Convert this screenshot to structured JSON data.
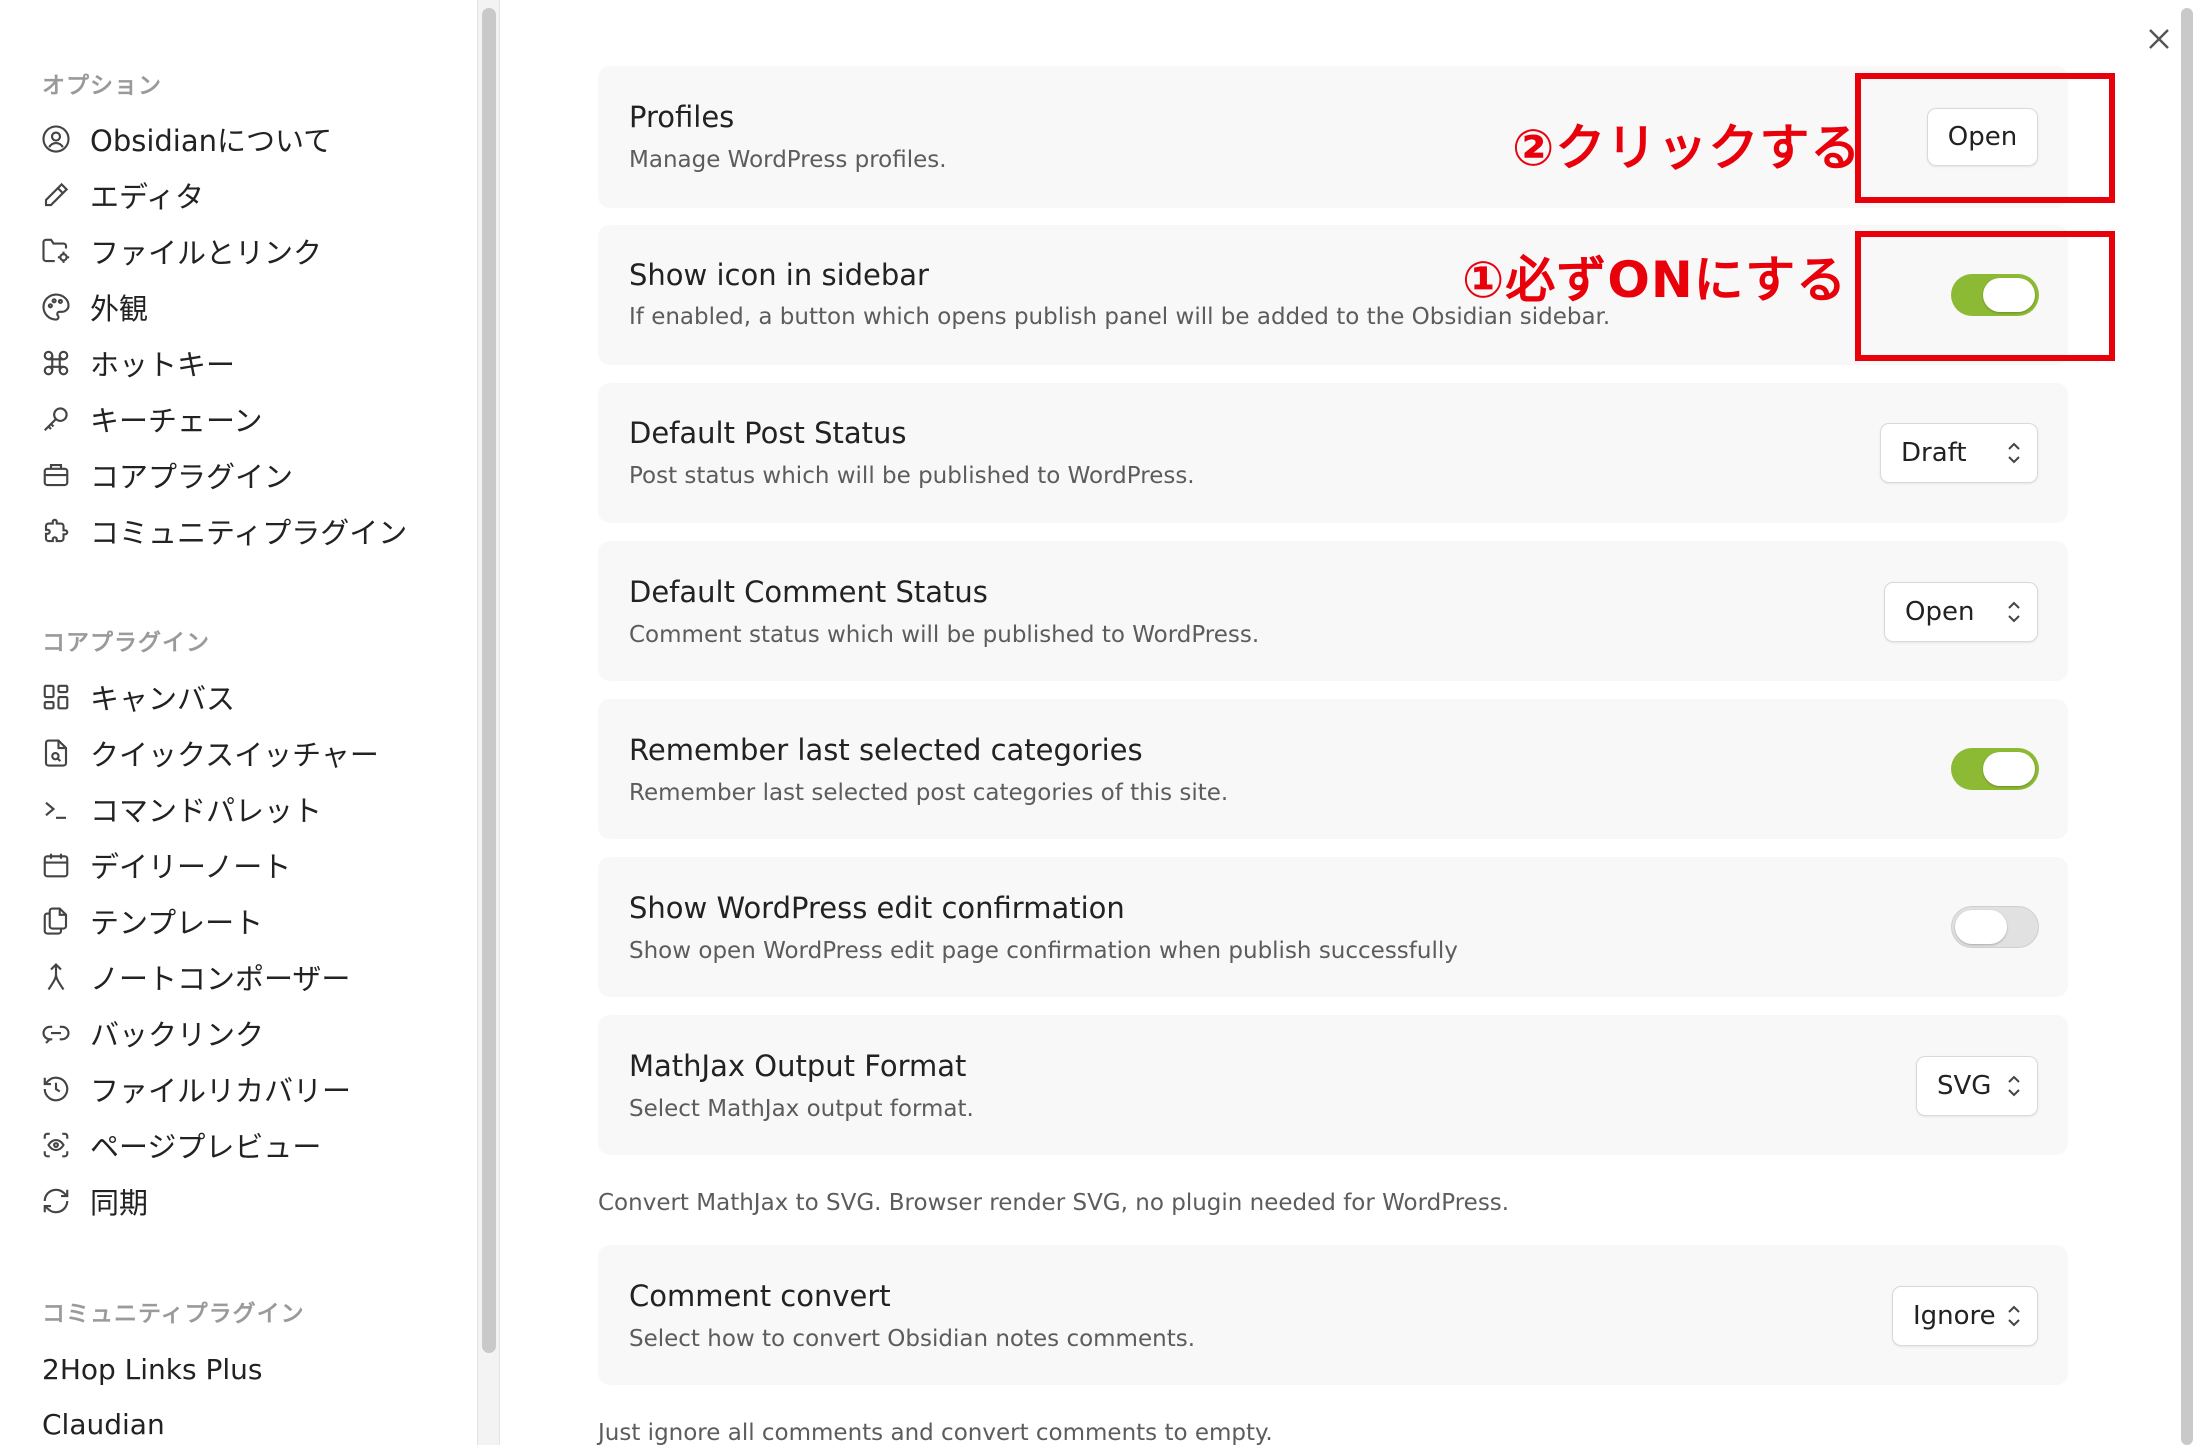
{
  "sidebar": {
    "sections": [
      {
        "title": "オプション",
        "items": [
          {
            "label": "Obsidianについて",
            "icon": "user-circle-icon"
          },
          {
            "label": "エディタ",
            "icon": "pencil-icon"
          },
          {
            "label": "ファイルとリンク",
            "icon": "folder-cog-icon"
          },
          {
            "label": "外観",
            "icon": "palette-icon"
          },
          {
            "label": "ホットキー",
            "icon": "command-icon"
          },
          {
            "label": "キーチェーン",
            "icon": "key-icon"
          },
          {
            "label": "コアプラグイン",
            "icon": "briefcase-icon"
          },
          {
            "label": "コミュニティプラグイン",
            "icon": "puzzle-icon"
          }
        ]
      },
      {
        "title": "コアプラグイン",
        "items": [
          {
            "label": "キャンバス",
            "icon": "layout-dashboard-icon"
          },
          {
            "label": "クイックスイッチャー",
            "icon": "file-search-icon"
          },
          {
            "label": "コマンドパレット",
            "icon": "terminal-icon"
          },
          {
            "label": "デイリーノート",
            "icon": "calendar-icon"
          },
          {
            "label": "テンプレート",
            "icon": "files-icon"
          },
          {
            "label": "ノートコンポーザー",
            "icon": "merge-icon"
          },
          {
            "label": "バックリンク",
            "icon": "link-icon"
          },
          {
            "label": "ファイルリカバリー",
            "icon": "history-icon"
          },
          {
            "label": "ページプレビュー",
            "icon": "scan-eye-icon"
          },
          {
            "label": "同期",
            "icon": "refresh-icon"
          }
        ]
      },
      {
        "title": "コミュニティプラグイン",
        "items": [
          {
            "label": "2Hop Links Plus"
          },
          {
            "label": "Claudian"
          }
        ]
      }
    ]
  },
  "settings": {
    "profiles": {
      "title": "Profiles",
      "desc": "Manage WordPress profiles.",
      "button_label": "Open"
    },
    "show_icon": {
      "title": "Show icon in sidebar",
      "desc": "If enabled, a button which opens publish panel will be added to the Obsidian sidebar.",
      "enabled": true
    },
    "default_post_status": {
      "title": "Default Post Status",
      "desc": "Post status which will be published to WordPress.",
      "value": "Draft"
    },
    "default_comment_status": {
      "title": "Default Comment Status",
      "desc": "Comment status which will be published to WordPress.",
      "value": "Open"
    },
    "remember_categories": {
      "title": "Remember last selected categories",
      "desc": "Remember last selected post categories of this site.",
      "enabled": true
    },
    "edit_confirmation": {
      "title": "Show WordPress edit confirmation",
      "desc": "Show open WordPress edit page confirmation when publish successfully",
      "enabled": false
    },
    "mathjax": {
      "title": "MathJax Output Format",
      "desc": "Select MathJax output format.",
      "value": "SVG",
      "note": "Convert MathJax to SVG. Browser render SVG, no plugin needed for WordPress."
    },
    "comment_convert": {
      "title": "Comment convert",
      "desc": "Select how to convert Obsidian notes comments.",
      "value": "Ignore",
      "note": "Just ignore all comments and convert comments to empty."
    }
  },
  "annotations": {
    "step2": "②クリックする",
    "step1": "①必ずONにする",
    "color": "#e8000b"
  },
  "colors": {
    "toggle_on": "#8dba34",
    "toggle_off": "#e1e1e1",
    "card_bg": "#f8f8f8"
  }
}
